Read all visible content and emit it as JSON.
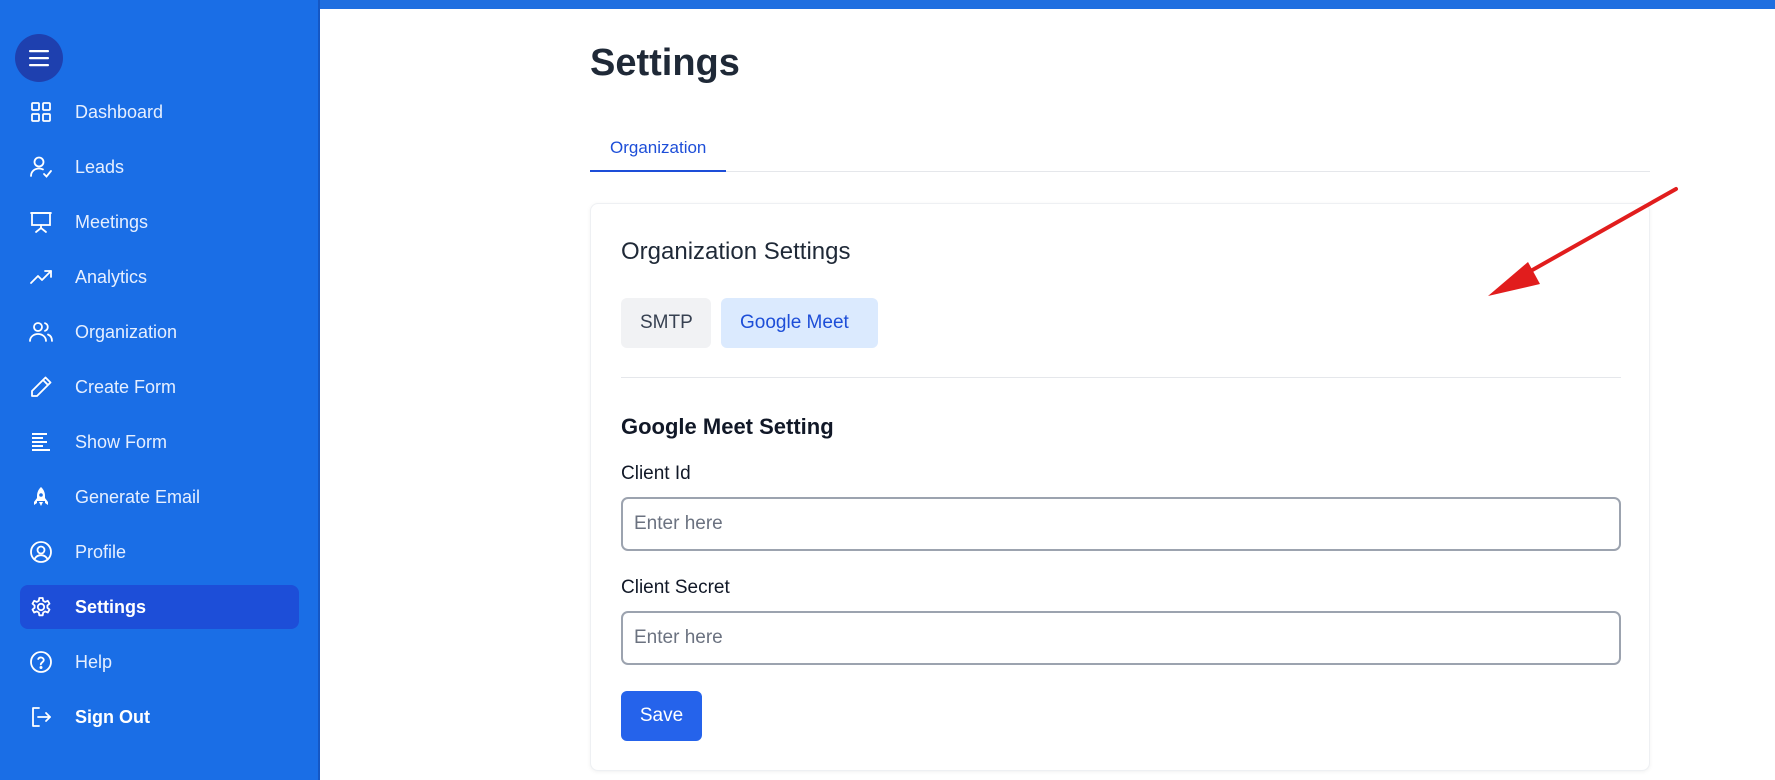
{
  "sidebar": {
    "items": [
      {
        "label": "Dashboard",
        "icon": "grid-icon"
      },
      {
        "label": "Leads",
        "icon": "user-check-icon"
      },
      {
        "label": "Meetings",
        "icon": "presentation-icon"
      },
      {
        "label": "Analytics",
        "icon": "trending-up-icon"
      },
      {
        "label": "Organization",
        "icon": "users-icon"
      },
      {
        "label": "Create Form",
        "icon": "pencil-icon"
      },
      {
        "label": "Show Form",
        "icon": "align-left-icon"
      },
      {
        "label": "Generate Email",
        "icon": "rocket-icon"
      },
      {
        "label": "Profile",
        "icon": "user-circle-icon"
      },
      {
        "label": "Settings",
        "icon": "gear-icon"
      },
      {
        "label": "Help",
        "icon": "help-circle-icon"
      },
      {
        "label": "Sign Out",
        "icon": "sign-out-icon"
      }
    ],
    "active": "Settings"
  },
  "page": {
    "title": "Settings",
    "tabs": [
      {
        "label": "Organization"
      }
    ]
  },
  "card": {
    "title": "Organization Settings",
    "subtabs": [
      {
        "label": "SMTP"
      },
      {
        "label": "Google Meet"
      }
    ],
    "active_subtab": "Google Meet",
    "section_title": "Google Meet Setting",
    "fields": [
      {
        "label": "Client Id",
        "placeholder": "Enter here",
        "value": ""
      },
      {
        "label": "Client Secret",
        "placeholder": "Enter here",
        "value": ""
      }
    ],
    "save_label": "Save"
  },
  "colors": {
    "sidebar_bg": "#1a6ee6",
    "active_item_bg": "#1d4ed8",
    "accent": "#2563eb",
    "arrow": "#e11d1d"
  }
}
